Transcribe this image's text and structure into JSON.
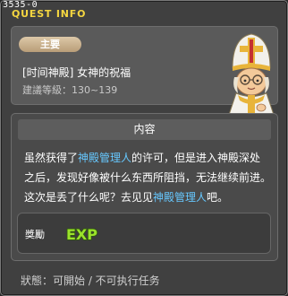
{
  "window": {
    "id_text": "3535-0",
    "title": "QUEST INFO"
  },
  "quest": {
    "badge": "主要",
    "title": "[时间神殿] 女神的祝福",
    "level": "建議等級：130~139"
  },
  "content": {
    "header": "内容",
    "description": {
      "p1": "虽然获得了",
      "npc1": "神殿管理人",
      "p2": "的许可，但是进入神殿深处之后，发现好像被什么东西所阻挡，无法继续前进。这次是丢了什么呢？去见见",
      "npc2": "神殿管理人",
      "p3": "吧。"
    }
  },
  "reward": {
    "label": "獎勵",
    "icon": "exp-icon",
    "icon_text": "EXP"
  },
  "status": "狀態：可開始 / 不可执行任务",
  "colors": {
    "title": "#f4d640",
    "highlight": "#66c8ff",
    "badge": "#c9ad88",
    "exp": "#9be22c"
  }
}
